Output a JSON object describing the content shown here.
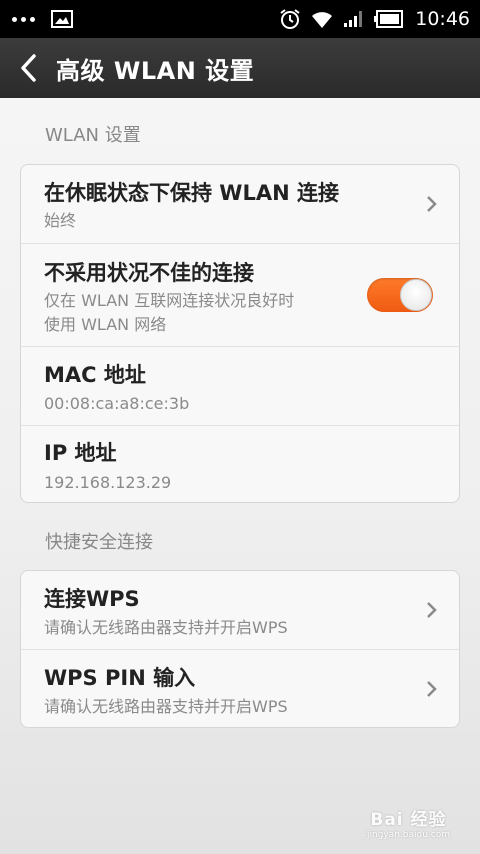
{
  "status_bar": {
    "time": "10:46",
    "icons": [
      "overflow-dots-icon",
      "image-notification-icon",
      "alarm-icon",
      "wifi-icon",
      "signal-icon",
      "battery-icon"
    ]
  },
  "header": {
    "title": "高级 WLAN 设置"
  },
  "sections": [
    {
      "header": "WLAN 设置",
      "items": [
        {
          "title": "在休眠状态下保持 WLAN 连接",
          "subtitle": "始终",
          "control": "chevron"
        },
        {
          "title": "不采用状况不佳的连接",
          "subtitle_line1": "仅在 WLAN 互联网连接状况良好时",
          "subtitle_line2": "使用 WLAN 网络",
          "control": "toggle",
          "toggle_on": true
        },
        {
          "title": "MAC 地址",
          "subtitle": "00:08:ca:a8:ce:3b",
          "control": "none"
        },
        {
          "title": "IP 地址",
          "subtitle": "192.168.123.29",
          "control": "none"
        }
      ]
    },
    {
      "header": "快捷安全连接",
      "items": [
        {
          "title": "连接WPS",
          "subtitle": "请确认无线路由器支持并开启WPS",
          "control": "chevron"
        },
        {
          "title": "WPS PIN 输入",
          "subtitle": "请确认无线路由器支持并开启WPS",
          "control": "chevron"
        }
      ]
    }
  ],
  "watermark": {
    "main": "Bai 经验",
    "sub": "jingyan.baidu.com"
  },
  "colors": {
    "toggle_on": "#f26a1b",
    "title_bar": "#333333",
    "status_bar": "#000000"
  }
}
